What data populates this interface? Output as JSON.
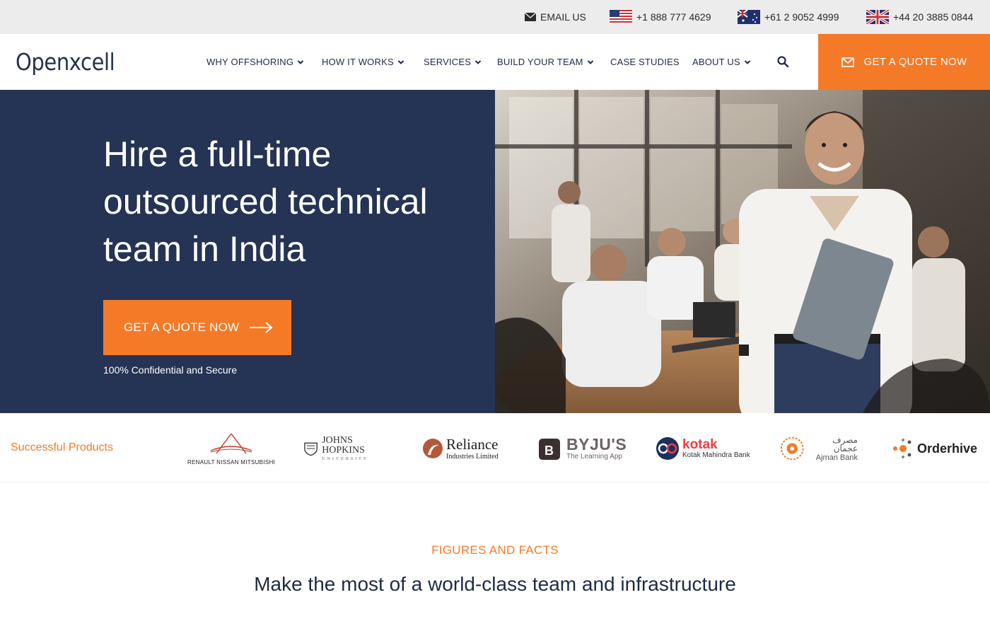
{
  "topbar": {
    "email_label": "EMAIL US",
    "phones": [
      {
        "country": "US",
        "number": "+1 888 777 4629"
      },
      {
        "country": "AU",
        "number": "+61 2 9052 4999"
      },
      {
        "country": "UK",
        "number": "+44 20 3885 0844"
      }
    ]
  },
  "header": {
    "logo": "Openxcell",
    "nav": [
      {
        "label": "WHY OFFSHORING",
        "has_dropdown": true
      },
      {
        "label": "HOW IT WORKS",
        "has_dropdown": true
      },
      {
        "label": "SERVICES",
        "has_dropdown": true
      },
      {
        "label": "BUILD YOUR TEAM",
        "has_dropdown": true
      },
      {
        "label": "CASE STUDIES",
        "has_dropdown": false
      },
      {
        "label": "ABOUT US",
        "has_dropdown": true
      }
    ],
    "quote_button": "GET A QUOTE NOW"
  },
  "hero": {
    "title_lines": [
      "Hire a full-time",
      "outsourced technical",
      "team in India"
    ],
    "cta": "GET A QUOTE NOW",
    "note": "100% Confidential and Secure"
  },
  "products": {
    "label": "Successful Products",
    "logos": [
      {
        "name": "RENAULT NISSAN MITSUBISHI"
      },
      {
        "name": "JOHNS HOPKINS",
        "sub": "UNIVERSITY"
      },
      {
        "name": "Reliance",
        "sub": "Industries Limited"
      },
      {
        "name": "BYJU'S",
        "sub": "The Learning App"
      },
      {
        "name": "kotak",
        "sub": "Kotak Mahindra Bank"
      },
      {
        "name": "مصرف عجمان",
        "sub": "Ajman Bank"
      },
      {
        "name": "Orderhive"
      }
    ]
  },
  "figures": {
    "kicker": "FIGURES AND FACTS",
    "title": "Make the most of a world-class team and infrastructure"
  },
  "colors": {
    "accent": "#f47a28",
    "navy": "#253354",
    "text": "#1f2a44",
    "topbar_bg": "#ececec"
  }
}
